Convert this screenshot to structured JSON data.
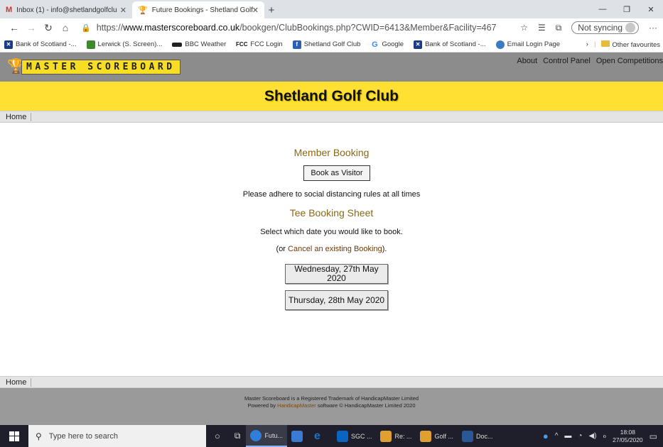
{
  "browser": {
    "tabs": [
      {
        "label": "Inbox (1) - info@shetlandgolfclu",
        "icon": "gmail-icon",
        "active": false
      },
      {
        "label": "Future Bookings - Shetland Golf",
        "icon": "trophy-icon",
        "active": true
      }
    ],
    "new_tab": "+",
    "url_prefix": "https://",
    "url_host": "www.masterscoreboard.co.uk",
    "url_path": "/bookgen/ClubBookings.php?CWID=6413&Member&Facility=467",
    "sync_label": "Not syncing",
    "favourites": [
      {
        "label": "Bank of Scotland -...",
        "color": "#1a3a8a"
      },
      {
        "label": "Lerwick (S. Screen)...",
        "color": "#3c8a2e"
      },
      {
        "label": "BBC Weather",
        "color": "#222222"
      },
      {
        "label": "FCC Login",
        "color": "#111111"
      },
      {
        "label": "Shetland Golf Club",
        "color": "#2b5fb4"
      },
      {
        "label": "Google",
        "color": "#4285f4"
      },
      {
        "label": "Bank of Scotland -...",
        "color": "#1a3a8a"
      },
      {
        "label": "Email Login Page",
        "color": "#3b7bbf"
      }
    ],
    "other_favourites": "Other favourites"
  },
  "site": {
    "logo_text": "MASTER SCOREBOARD",
    "nav": [
      "About",
      "Control Panel",
      "Open Competitions"
    ],
    "club_name": "Shetland Golf Club",
    "breadcrumb_home": "Home"
  },
  "main": {
    "member_booking_title": "Member Booking",
    "visitor_button": "Book as Visitor",
    "distancing_note": "Please adhere to social distancing rules at all times",
    "tee_sheet_title": "Tee Booking Sheet",
    "select_date_text": "Select which date you would like to book.",
    "cancel_prefix": "(or ",
    "cancel_link": "Cancel an existing Booking",
    "cancel_suffix": ").",
    "dates": [
      "Wednesday, 27th May 2020",
      "Thursday, 28th May 2020"
    ]
  },
  "footer": {
    "line1": "Master Scoreboard is a Registered Trademark of HandicapMaster Limited",
    "line2_prefix": "Powered by ",
    "line2_link": "HandicapMaster",
    "line2_suffix": " software © HandicapMaster Limited 2020"
  },
  "taskbar": {
    "search_placeholder": "Type here to search",
    "apps": [
      {
        "label": "Futu...",
        "color": "#2f7fd8",
        "active": true
      },
      {
        "label": "",
        "color": "#3a7bd5",
        "active": false
      },
      {
        "label": "",
        "color": "#1a73c8",
        "active": false
      },
      {
        "label": "SGC ...",
        "color": "#0a64c2",
        "active": false
      },
      {
        "label": "Re: ...",
        "color": "#e0a030",
        "active": false
      },
      {
        "label": "Golf ...",
        "color": "#e0a030",
        "active": false
      },
      {
        "label": "Doc...",
        "color": "#2b5797",
        "active": false
      }
    ],
    "time": "18:08",
    "date": "27/05/2020"
  }
}
